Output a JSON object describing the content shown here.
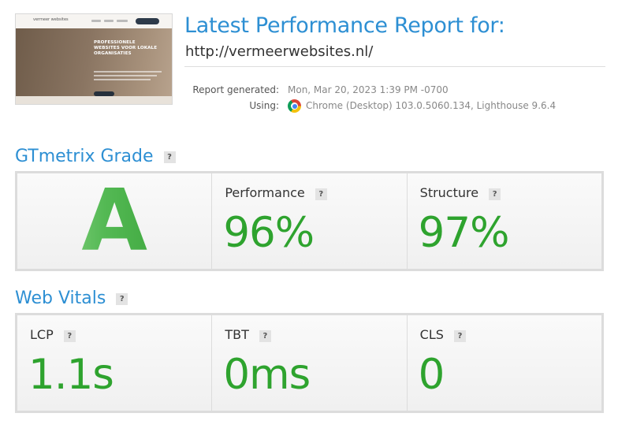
{
  "report": {
    "title": "Latest Performance Report for:",
    "url": "http://vermeerwebsites.nl/",
    "generated_label": "Report generated:",
    "generated_value": "Mon, Mar 20, 2023 1:39 PM -0700",
    "using_label": "Using:",
    "using_value": "Chrome (Desktop) 103.0.5060.134, Lighthouse 9.6.4",
    "browser_icon": "chrome-icon"
  },
  "thumbnail": {
    "logo": "vermeer websites",
    "hero_text_line1": "PROFESSIONELE",
    "hero_text_line2": "WEBSITES VOOR LOKALE",
    "hero_text_line3": "ORGANISATIES"
  },
  "grade_section": {
    "title": "GTmetrix Grade",
    "help": "?",
    "grade": "A",
    "performance_label": "Performance",
    "performance_value": "96%",
    "structure_label": "Structure",
    "structure_value": "97%"
  },
  "vitals_section": {
    "title": "Web Vitals",
    "help": "?",
    "items": [
      {
        "label": "LCP",
        "value": "1.1s"
      },
      {
        "label": "TBT",
        "value": "0ms"
      },
      {
        "label": "CLS",
        "value": "0"
      }
    ]
  },
  "colors": {
    "accent": "#2d8fd3",
    "good": "#2ea32e"
  }
}
